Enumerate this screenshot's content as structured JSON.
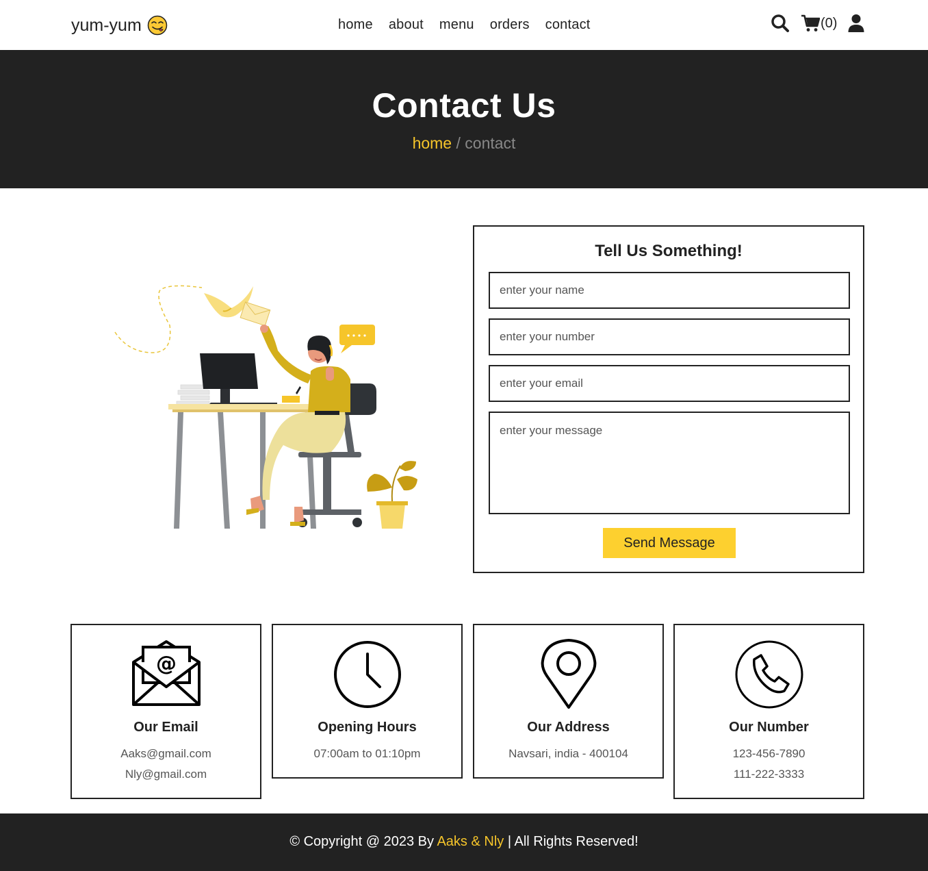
{
  "header": {
    "logo_text": "yum-yum",
    "nav": [
      {
        "label": "home"
      },
      {
        "label": "about"
      },
      {
        "label": "menu"
      },
      {
        "label": "orders"
      },
      {
        "label": "contact"
      }
    ],
    "cart_count": "(0)",
    "icons": [
      "search-icon",
      "cart-icon",
      "user-icon"
    ]
  },
  "banner": {
    "title": "Contact Us",
    "breadcrumb_home": "home",
    "breadcrumb_sep": " / ",
    "breadcrumb_current": "contact"
  },
  "form": {
    "title": "Tell Us Something!",
    "name_placeholder": "enter your name",
    "number_placeholder": "enter your number",
    "email_placeholder": "enter your email",
    "message_placeholder": "enter your message",
    "submit_label": "Send Message"
  },
  "info_cards": [
    {
      "icon": "envelope-icon",
      "title": "Our Email",
      "lines": [
        "Aaks@gmail.com",
        "Nly@gmail.com"
      ]
    },
    {
      "icon": "clock-icon",
      "title": "Opening Hours",
      "lines": [
        "07:00am to 01:10pm"
      ]
    },
    {
      "icon": "map-pin-icon",
      "title": "Our Address",
      "lines": [
        "Navsari, india - 400104"
      ]
    },
    {
      "icon": "phone-icon",
      "title": "Our Number",
      "lines": [
        "123-456-7890",
        "111-222-3333"
      ]
    }
  ],
  "footer": {
    "prefix": "© Copyright @ 2023 By ",
    "authors": "Aaks & Nly",
    "suffix": " | All Rights Reserved!"
  },
  "colors": {
    "accent": "#fdd02f",
    "dark": "#222222",
    "muted": "#888888"
  }
}
